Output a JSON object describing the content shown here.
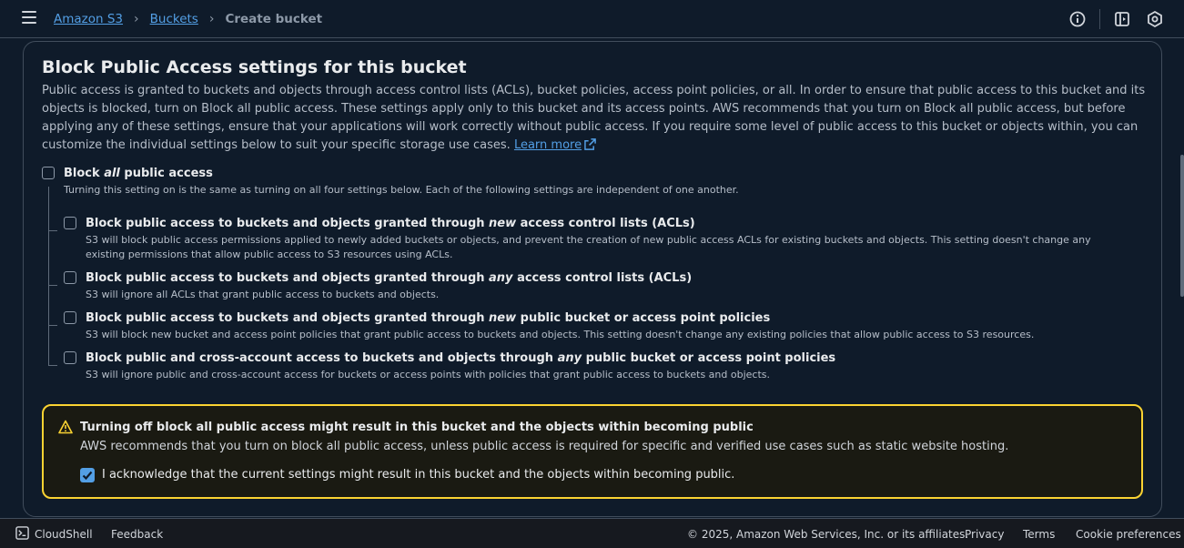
{
  "breadcrumb": {
    "root": "Amazon S3",
    "parent": "Buckets",
    "current": "Create bucket"
  },
  "section": {
    "title": "Block Public Access settings for this bucket",
    "description": "Public access is granted to buckets and objects through access control lists (ACLs), bucket policies, access point policies, or all. In order to ensure that public access to this bucket and its objects is blocked, turn on Block all public access. These settings apply only to this bucket and its access points. AWS recommends that you turn on Block all public access, but before applying any of these settings, ensure that your applications will work correctly without public access. If you require some level of public access to this bucket or objects within, you can customize the individual settings below to suit your specific storage use cases.",
    "learn_more": "Learn more"
  },
  "block_all": {
    "label_pre": "Block ",
    "label_em": "all",
    "label_post": " public access",
    "description": "Turning this setting on is the same as turning on all four settings below. Each of the following settings are independent of one another.",
    "checked": false
  },
  "options": [
    {
      "pre": "Block public access to buckets and objects granted through ",
      "em": "new",
      "post": " access control lists (ACLs)",
      "desc": "S3 will block public access permissions applied to newly added buckets or objects, and prevent the creation of new public access ACLs for existing buckets and objects. This setting doesn't change any existing permissions that allow public access to S3 resources using ACLs.",
      "checked": false
    },
    {
      "pre": "Block public access to buckets and objects granted through ",
      "em": "any",
      "post": " access control lists (ACLs)",
      "desc": "S3 will ignore all ACLs that grant public access to buckets and objects.",
      "checked": false
    },
    {
      "pre": "Block public access to buckets and objects granted through ",
      "em": "new",
      "post": " public bucket or access point policies",
      "desc": "S3 will block new bucket and access point policies that grant public access to buckets and objects. This setting doesn't change any existing policies that allow public access to S3 resources.",
      "checked": false
    },
    {
      "pre": "Block public and cross-account access to buckets and objects through ",
      "em": "any",
      "post": " public bucket or access point policies",
      "desc": "S3 will ignore public and cross-account access for buckets or access points with policies that grant public access to buckets and objects.",
      "checked": false
    }
  ],
  "warning": {
    "title": "Turning off block all public access might result in this bucket and the objects within becoming public",
    "text": "AWS recommends that you turn on block all public access, unless public access is required for specific and verified use cases such as static website hosting.",
    "acknowledge": "I acknowledge that the current settings might result in this bucket and the objects within becoming public.",
    "acknowledged": true
  },
  "footer": {
    "cloudshell": "CloudShell",
    "feedback": "Feedback",
    "copyright": "© 2025, Amazon Web Services, Inc. or its affiliates.",
    "privacy": "Privacy",
    "terms": "Terms",
    "cookies": "Cookie preferences"
  },
  "colors": {
    "accent": "#539fe5",
    "warning_border": "#fbd332",
    "background": "#0f1b2a"
  }
}
